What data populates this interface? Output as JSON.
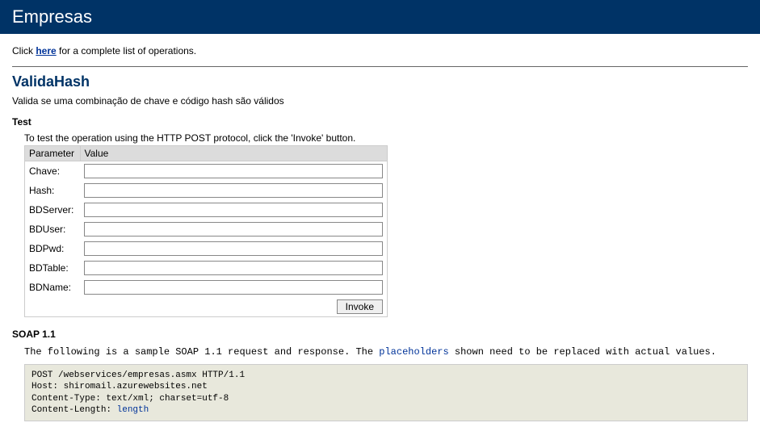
{
  "header": {
    "title": "Empresas"
  },
  "intro": {
    "prefix": "Click ",
    "link": "here",
    "suffix": " for a complete list of operations."
  },
  "operation": {
    "name": "ValidaHash",
    "description": "Valida se uma combinação de chave e código hash são válidos"
  },
  "test": {
    "heading": "Test",
    "note": "To test the operation using the HTTP POST protocol, click the 'Invoke' button.",
    "columns": {
      "param": "Parameter",
      "value": "Value"
    },
    "params": [
      {
        "label": "Chave:"
      },
      {
        "label": "Hash:"
      },
      {
        "label": "BDServer:"
      },
      {
        "label": "BDUser:"
      },
      {
        "label": "BDPwd:"
      },
      {
        "label": "BDTable:"
      },
      {
        "label": "BDName:"
      }
    ],
    "invoke_label": "Invoke"
  },
  "soap": {
    "heading": "SOAP 1.1",
    "desc_prefix": "The following is a sample SOAP 1.1 request and response. The ",
    "desc_placeholder": "placeholders",
    "desc_suffix": " shown need to be replaced with actual values.",
    "code": {
      "line1": "POST /webservices/empresas.asmx HTTP/1.1",
      "line2": "Host: shiromail.azurewebsites.net",
      "line3": "Content-Type: text/xml; charset=utf-8",
      "line4_prefix": "Content-Length: ",
      "line4_placeholder": "length"
    }
  }
}
